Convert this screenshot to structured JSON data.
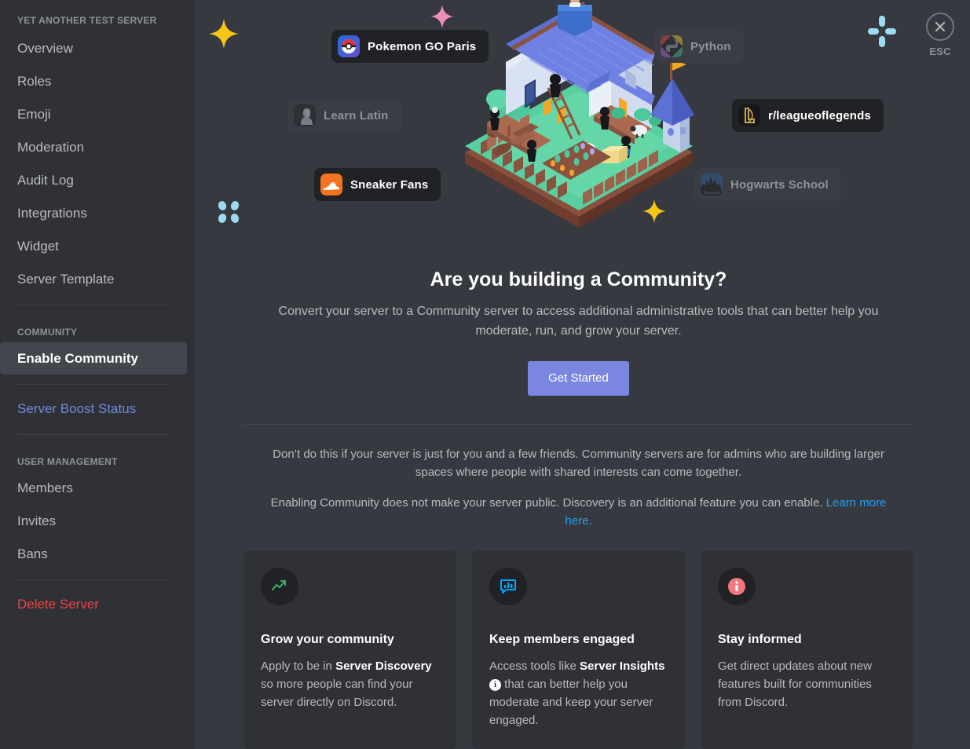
{
  "sidebar": {
    "server_name": "YET ANOTHER TEST SERVER",
    "items": [
      {
        "label": "Overview"
      },
      {
        "label": "Roles"
      },
      {
        "label": "Emoji"
      },
      {
        "label": "Moderation"
      },
      {
        "label": "Audit Log"
      },
      {
        "label": "Integrations"
      },
      {
        "label": "Widget"
      },
      {
        "label": "Server Template"
      }
    ],
    "community_header": "COMMUNITY",
    "community_item": "Enable Community",
    "boost_item": "Server Boost Status",
    "user_management_header": "USER MANAGEMENT",
    "user_items": [
      {
        "label": "Members"
      },
      {
        "label": "Invites"
      },
      {
        "label": "Bans"
      }
    ],
    "delete_item": "Delete Server"
  },
  "close": {
    "icon": "close-icon",
    "label": "ESC"
  },
  "hero": {
    "illustration": "isometric-community-house-illustration",
    "pills": [
      {
        "label": "Pokemon GO Paris",
        "icon": "pokeball-icon",
        "style": "bright"
      },
      {
        "label": "Learn Latin",
        "icon": "roman-bust-icon",
        "style": "dim"
      },
      {
        "label": "Sneaker Fans",
        "icon": "sneaker-icon",
        "style": "bright"
      },
      {
        "label": "Python",
        "icon": "python-logo-icon",
        "style": "dim"
      },
      {
        "label": "r/leagueoflegends",
        "icon": "league-of-legends-icon",
        "style": "bright"
      },
      {
        "label": "Hogwarts School",
        "icon": "hogwarts-castle-icon",
        "style": "dim"
      }
    ],
    "sparkles": [
      {
        "name": "yellow-star-sparkle",
        "color": "#f5c518"
      },
      {
        "name": "pink-star-sparkle",
        "color": "#f08dba"
      },
      {
        "name": "blue-dots-sparkle",
        "color": "#9bdcf0"
      },
      {
        "name": "cyan-cross-sparkle",
        "color": "#9bdcf0"
      },
      {
        "name": "yellow-star-sparkle-2",
        "color": "#f5c518"
      }
    ]
  },
  "main": {
    "title": "Are you building a Community?",
    "subtitle": "Convert your server to a Community server to access additional administrative tools that can better help you moderate, run, and grow your server.",
    "cta_label": "Get Started",
    "cta_color": "#7b86e0",
    "note_1": "Don’t do this if your server is just for you and a few friends. Community servers are for admins who are building larger spaces where people with shared interests can come together.",
    "note_2_text": "Enabling Community does not make your server public. Discovery is an additional feature you can enable. ",
    "note_2_link": "Learn more here.",
    "link_color": "#22a0f0"
  },
  "cards": [
    {
      "icon": "trending-up-icon",
      "icon_color": "#3ba55d",
      "title": "Grow your community",
      "body_1": "Apply to be in ",
      "body_bold": "Server Discovery",
      "body_2": " so more people can find your server directly on Discord.",
      "has_info_badge": false
    },
    {
      "icon": "insights-chat-icon",
      "icon_color": "#00a8fc",
      "title": "Keep members engaged",
      "body_1": "Access tools like ",
      "body_bold": "Server Insights",
      "body_2": " that can better help you moderate and keep your server engaged.",
      "has_info_badge": true,
      "info_badge": "i"
    },
    {
      "icon": "info-circle-icon",
      "icon_color": "#f2777f",
      "title": "Stay informed",
      "body_1": "Get direct updates about new features built for communities from Discord.",
      "body_bold": "",
      "body_2": "",
      "has_info_badge": false
    }
  ],
  "theme": {
    "sidebar_bg": "#2f3136",
    "main_bg": "#36393f",
    "active_bg": "#42464d",
    "text_muted": "#b9bbbe",
    "danger": "#ed4245",
    "blurple": "#7289da"
  }
}
